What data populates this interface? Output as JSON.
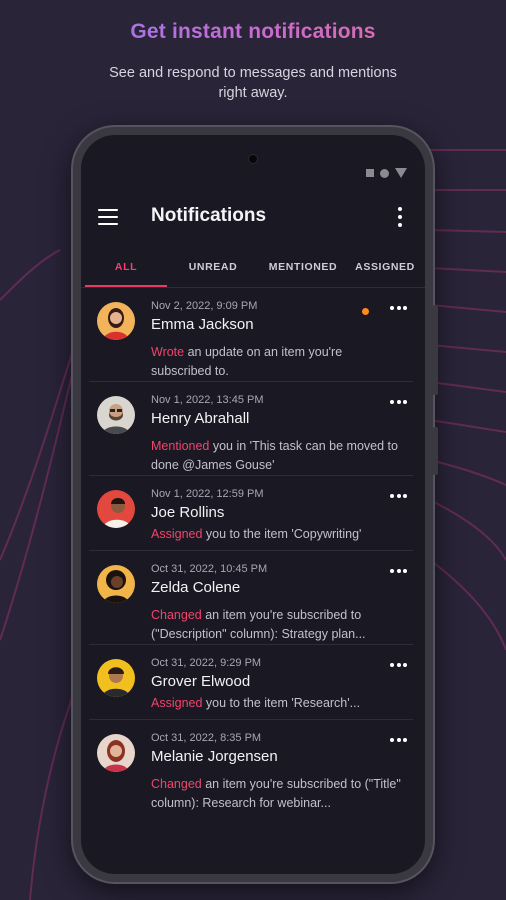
{
  "promo": {
    "headline": "Get instant notifications",
    "subhead": "See and respond to messages and mentions right away."
  },
  "appbar": {
    "title": "Notifications",
    "menu_icon": "hamburger-menu-icon",
    "overflow_icon": "more-vertical-icon"
  },
  "tabs": [
    {
      "label": "ALL",
      "active": true
    },
    {
      "label": "UNREAD",
      "active": false
    },
    {
      "label": "MENTIONED",
      "active": false
    },
    {
      "label": "ASSIGNED",
      "active": false
    }
  ],
  "colors": {
    "accent": "#e93a62",
    "background": "#292438",
    "screen": "#1a1923",
    "unread_dot": "#ff8a1e"
  },
  "notifications": [
    {
      "date": "Nov 2, 2022, 9:09 PM",
      "name": "Emma Jackson",
      "verb": "Wrote",
      "text": " an update on an item you're subscribed to.",
      "unread": true
    },
    {
      "date": "Nov 1, 2022, 13:45 PM",
      "name": "Henry Abrahall",
      "verb": "Mentioned",
      "text": " you in 'This task can be moved to done @James Gouse'",
      "unread": false
    },
    {
      "date": "Nov 1, 2022, 12:59 PM",
      "name": "Joe Rollins",
      "verb": "Assigned",
      "text": " you to the item 'Copywriting'",
      "unread": false
    },
    {
      "date": "Oct 31, 2022, 10:45 PM",
      "name": "Zelda Colene",
      "verb": "Changed",
      "text": " an item you're subscribed to (\"Description\" column): Strategy plan...",
      "unread": false
    },
    {
      "date": "Oct 31, 2022, 9:29 PM",
      "name": "Grover Elwood",
      "verb": "Assigned",
      "text": " you to the item 'Research'...",
      "unread": false
    },
    {
      "date": "Oct 31, 2022, 8:35 PM",
      "name": "Melanie Jorgensen",
      "verb": "Changed",
      "text": " an item you're subscribed to (\"Title\" column): Research for webinar...",
      "unread": false
    }
  ]
}
